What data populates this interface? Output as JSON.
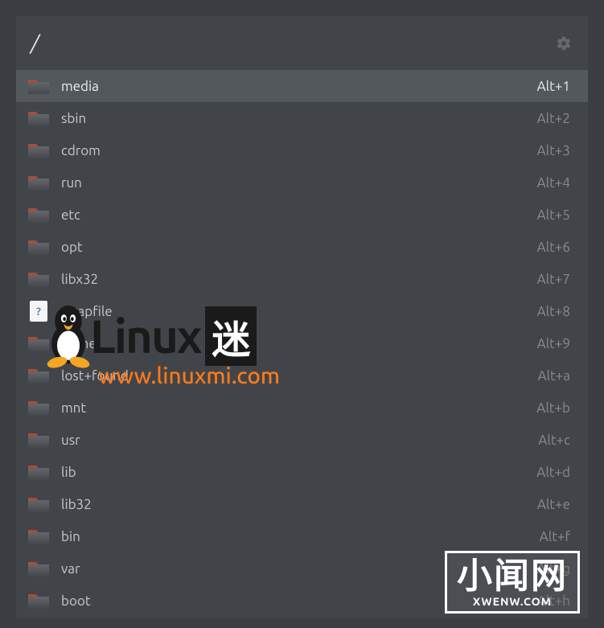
{
  "header": {
    "path": "/"
  },
  "items": [
    {
      "name": "media",
      "shortcut": "Alt+1",
      "type": "folder",
      "selected": true
    },
    {
      "name": "sbin",
      "shortcut": "Alt+2",
      "type": "folder",
      "selected": false
    },
    {
      "name": "cdrom",
      "shortcut": "Alt+3",
      "type": "folder",
      "selected": false
    },
    {
      "name": "run",
      "shortcut": "Alt+4",
      "type": "folder",
      "selected": false
    },
    {
      "name": "etc",
      "shortcut": "Alt+5",
      "type": "folder",
      "selected": false
    },
    {
      "name": "opt",
      "shortcut": "Alt+6",
      "type": "folder",
      "selected": false
    },
    {
      "name": "libx32",
      "shortcut": "Alt+7",
      "type": "folder",
      "selected": false
    },
    {
      "name": "swapfile",
      "shortcut": "Alt+8",
      "type": "file",
      "selected": false
    },
    {
      "name": "home",
      "shortcut": "Alt+9",
      "type": "folder",
      "selected": false
    },
    {
      "name": "lost+found",
      "shortcut": "Alt+a",
      "type": "folder",
      "selected": false
    },
    {
      "name": "mnt",
      "shortcut": "Alt+b",
      "type": "folder",
      "selected": false
    },
    {
      "name": "usr",
      "shortcut": "Alt+c",
      "type": "folder",
      "selected": false
    },
    {
      "name": "lib",
      "shortcut": "Alt+d",
      "type": "folder",
      "selected": false
    },
    {
      "name": "lib32",
      "shortcut": "Alt+e",
      "type": "folder",
      "selected": false
    },
    {
      "name": "bin",
      "shortcut": "Alt+f",
      "type": "folder",
      "selected": false
    },
    {
      "name": "var",
      "shortcut": "Alt+g",
      "type": "folder",
      "selected": false
    },
    {
      "name": "boot",
      "shortcut": "Alt+h",
      "type": "folder",
      "selected": false
    }
  ],
  "watermark": {
    "main_text": "Linux",
    "main_suffix": "迷",
    "url": "www.linuxmi.com",
    "bottom_cn": "小闻网",
    "bottom_url": "XWENW.COM"
  }
}
